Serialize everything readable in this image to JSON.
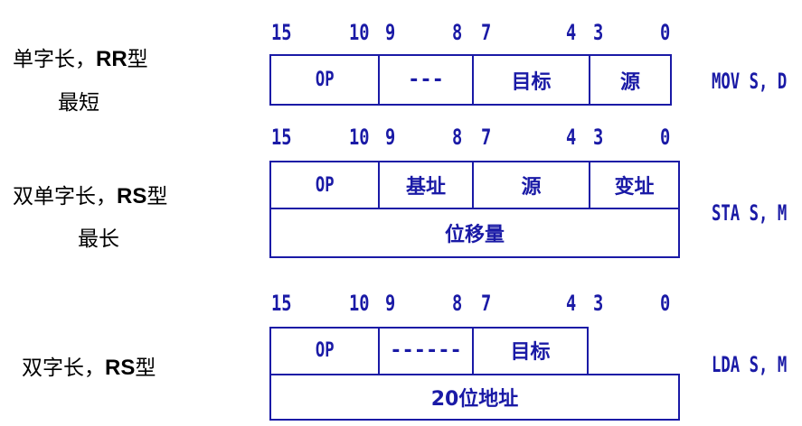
{
  "colors": {
    "accent": "#1a1aa6",
    "text": "#000000",
    "background": "#ffffff"
  },
  "formats": [
    {
      "label_main": "单字长，",
      "label_bold": "RR",
      "label_suffix": "型",
      "label_sub": "最短",
      "bits": [
        "15",
        "10",
        "9",
        "8",
        "7",
        "4",
        "3",
        "0"
      ],
      "fields": [
        "OP",
        "---",
        "目标",
        "源"
      ],
      "instruction": "MOV S, D"
    },
    {
      "label_main": "双单字长，",
      "label_bold": "RS",
      "label_suffix": "型",
      "label_sub": "最长",
      "bits": [
        "15",
        "10",
        "9",
        "8",
        "7",
        "4",
        "3",
        "0"
      ],
      "fields": [
        "OP",
        "基址",
        "源",
        "变址"
      ],
      "second_word": "位移量",
      "instruction": "STA S, M"
    },
    {
      "label_main": "双字长，",
      "label_bold": "RS",
      "label_suffix": "型",
      "bits": [
        "15",
        "10",
        "9",
        "8",
        "7",
        "4",
        "3",
        "0"
      ],
      "fields": [
        "OP",
        "------",
        "目标",
        ""
      ],
      "second_word": "20位地址",
      "instruction": "LDA S, M"
    }
  ]
}
